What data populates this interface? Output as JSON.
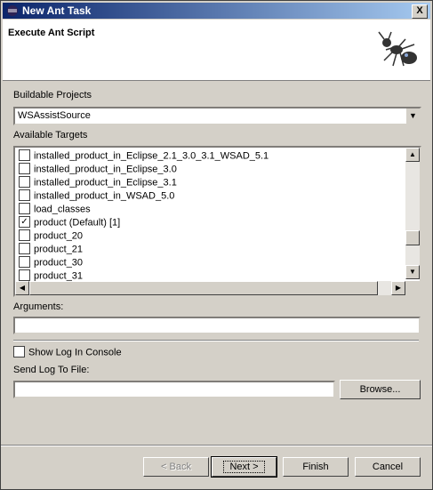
{
  "window": {
    "title": "New Ant Task",
    "close_glyph": "X"
  },
  "header": {
    "title": "Execute Ant Script",
    "logo_icon": "ant-logo-icon"
  },
  "buildable_projects": {
    "label": "Buildable Projects",
    "selected": "WSAssistSource"
  },
  "available_targets": {
    "label": "Available Targets",
    "items": [
      {
        "label": "installed_product_in_Eclipse_2.1_3.0_3.1_WSAD_5.1",
        "checked": false
      },
      {
        "label": "installed_product_in_Eclipse_3.0",
        "checked": false
      },
      {
        "label": "installed_product_in_Eclipse_3.1",
        "checked": false
      },
      {
        "label": "installed_product_in_WSAD_5.0",
        "checked": false
      },
      {
        "label": "load_classes",
        "checked": false
      },
      {
        "label": "product (Default) [1]",
        "checked": true
      },
      {
        "label": "product_20",
        "checked": false
      },
      {
        "label": "product_21",
        "checked": false
      },
      {
        "label": "product_30",
        "checked": false
      },
      {
        "label": "product_31",
        "checked": false
      }
    ]
  },
  "arguments": {
    "label": "Arguments:",
    "value": ""
  },
  "show_log": {
    "label": "Show Log In Console",
    "checked": false
  },
  "send_log": {
    "label": "Send Log To File:",
    "value": "",
    "browse_label": "Browse..."
  },
  "footer": {
    "back_label": "< Back",
    "next_label": "Next >",
    "finish_label": "Finish",
    "cancel_label": "Cancel"
  },
  "colors": {
    "title_gradient_start": "#0a246a",
    "title_gradient_end": "#a6caf0",
    "face": "#d4d0c8"
  }
}
